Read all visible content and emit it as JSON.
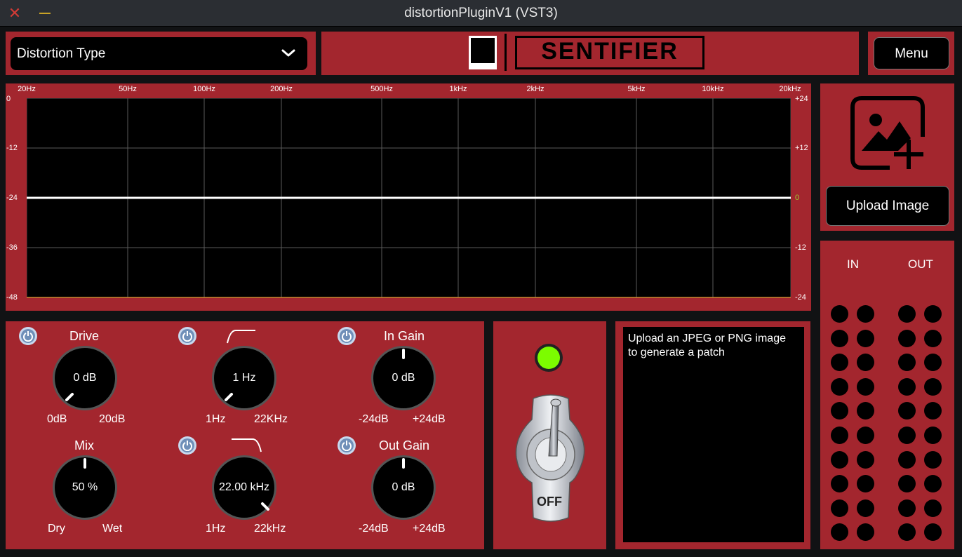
{
  "window": {
    "title": "distortionPluginV1 (VST3)"
  },
  "header": {
    "distortion_type": "Distortion Type",
    "logo_text": "SENTIFIER",
    "menu_label": "Menu"
  },
  "graph": {
    "freq_labels": [
      "20Hz",
      "50Hz",
      "100Hz",
      "200Hz",
      "500Hz",
      "1kHz",
      "2kHz",
      "5kHz",
      "10kHz",
      "20kHz"
    ],
    "left_db_labels": [
      "0",
      "-12",
      "-24",
      "-36",
      "-48"
    ],
    "right_db_labels": [
      "+24",
      "+12",
      "0",
      "-12",
      "-24"
    ],
    "response_line_db": 0
  },
  "image_panel": {
    "upload_label": "Upload Image"
  },
  "meters": {
    "in_label": "IN",
    "out_label": "OUT"
  },
  "controls": {
    "drive": {
      "label": "Drive",
      "value": "0 dB",
      "min": "0dB",
      "max": "20dB"
    },
    "mix": {
      "label": "Mix",
      "value": "50 %",
      "min": "Dry",
      "max": "Wet"
    },
    "highpass": {
      "value": "1 Hz",
      "min": "1Hz",
      "max": "22KHz"
    },
    "lowpass": {
      "value": "22.00 kHz",
      "min": "1Hz",
      "max": "22kHz"
    },
    "in_gain": {
      "label": "In Gain",
      "value": "0 dB",
      "min": "-24dB",
      "max": "+24dB"
    },
    "out_gain": {
      "label": "Out Gain",
      "value": "0 dB",
      "min": "-24dB",
      "max": "+24dB"
    }
  },
  "bypass": {
    "switch_label": "OFF",
    "led_color": "#7CFC00"
  },
  "message": {
    "text": "Upload an JPEG or PNG image to generate a patch"
  },
  "colors": {
    "panel": "#a3262e",
    "background": "#111214"
  }
}
